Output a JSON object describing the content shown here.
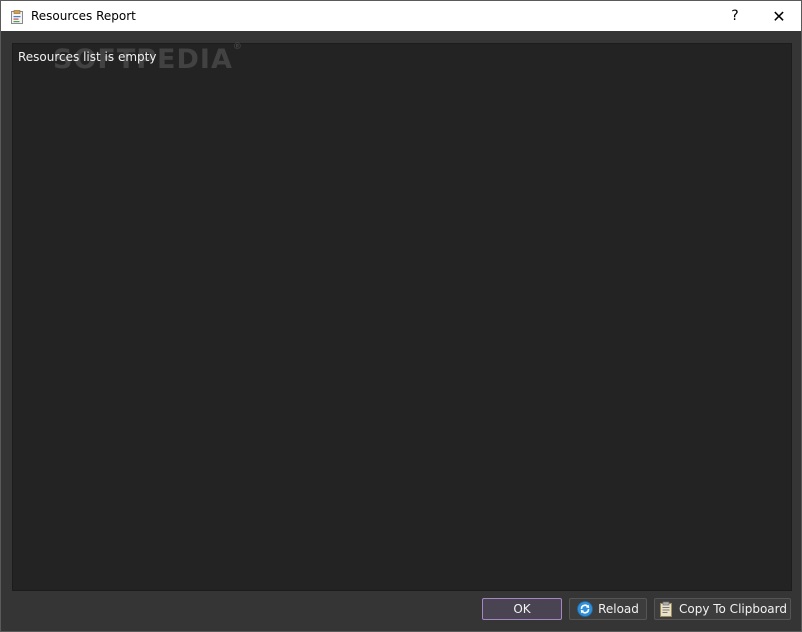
{
  "window": {
    "title": "Resources Report",
    "help_label": "?",
    "close_label": "✕"
  },
  "content": {
    "message": "Resources list is empty",
    "watermark": "SOFTPEDIA",
    "watermark_mark": "®"
  },
  "buttons": {
    "ok_label": "OK",
    "reload_label": "Reload",
    "copy_label": "Copy To Clipboard"
  },
  "icons": {
    "app": "report-icon",
    "reload": "reload-icon",
    "copy": "clipboard-icon"
  },
  "colors": {
    "background": "#353535",
    "content_bg": "#232323",
    "ok_border": "#a486c4",
    "text": "#f0f0f0"
  }
}
